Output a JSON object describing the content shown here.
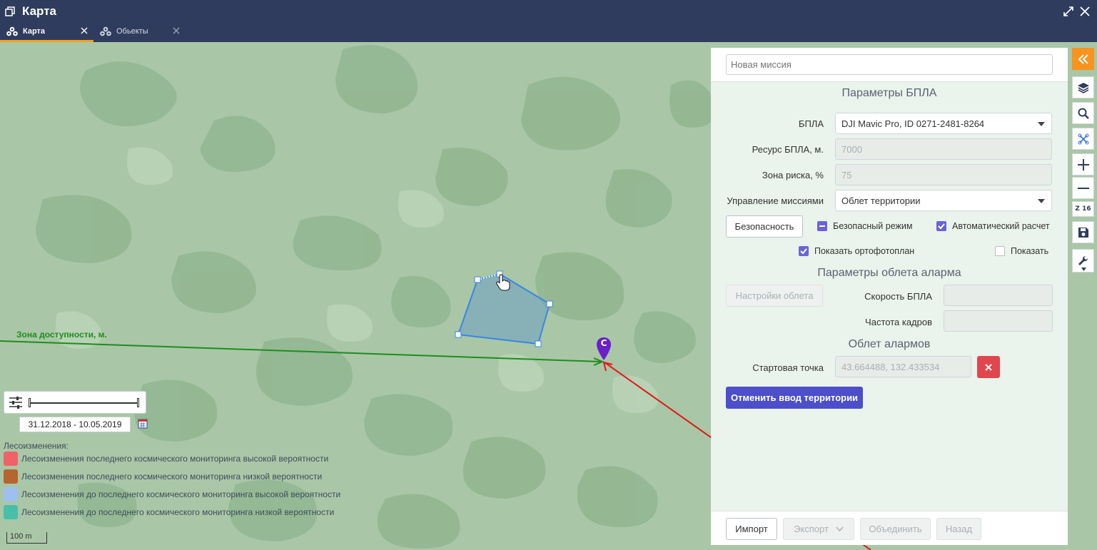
{
  "window": {
    "title": "Карта"
  },
  "tabs": [
    {
      "label": "Карта",
      "active": true
    },
    {
      "label": "Обьекты",
      "active": false
    }
  ],
  "map": {
    "zone_label": "Зона доступности, м.",
    "start_marker_letter": "C",
    "date_range": "31.12.2018 - 10.05.2019",
    "legend_title": "Лесоизменения:",
    "legend": [
      {
        "label": "Лесоизменения последнего космического мониторинга высокой вероятности",
        "color": "#f0626a"
      },
      {
        "label": "Лесоизменения последнего космического мониторинга низкой вероятности",
        "color": "#b5652f"
      },
      {
        "label": "Лесоизменения до последнего космического мониторинга высокой вероятности",
        "color": "#9fbff0"
      },
      {
        "label": "Лесоизменения до последнего космического мониторинга низкой вероятности",
        "color": "#48bfa8"
      }
    ],
    "scale_label": "100 m",
    "zoom_label": "Z 16"
  },
  "panel": {
    "mission_name_value": "",
    "mission_name_placeholder": "Новая миссия",
    "section_uav": "Параметры БПЛА",
    "uav_label": "БПЛА",
    "uav_value": "DJI Mavic Pro, ID 0271-2481-8264",
    "resource_label": "Ресурс БПЛА, м.",
    "resource_value": "7000",
    "risk_label": "Зона риска, %",
    "risk_value": "75",
    "mission_ctrl_label": "Управление миссиями",
    "mission_ctrl_value": "Облет территории",
    "safety_button": "Безопасность",
    "safe_mode_label": "Безопасный режим",
    "auto_calc_label": "Автоматический расчет",
    "show_ortho_label": "Показать ортофотоплан",
    "show_label": "Показать",
    "section_alarm_params": "Параметры облета аларма",
    "flight_settings_button": "Настройки облета",
    "uav_speed_label": "Скорость БПЛА",
    "uav_speed_value": "",
    "frame_rate_label": "Частота кадров",
    "frame_rate_value": "",
    "section_alarm_flight": "Облет алармов",
    "start_point_label": "Стартовая точка",
    "start_point_value": "43.664488, 132.433534",
    "cancel_territory_button": "Отменить ввод территории"
  },
  "footer": {
    "import": "Импорт",
    "export": "Экспорт",
    "merge": "Объединить",
    "back": "Назад"
  },
  "colors": {
    "header": "#2f3c5e",
    "accent_orange": "#f7931e",
    "primary": "#4d4ec9",
    "danger": "#e0474c",
    "zone_line": "#1f8c1f",
    "route_line": "#e0181b"
  }
}
